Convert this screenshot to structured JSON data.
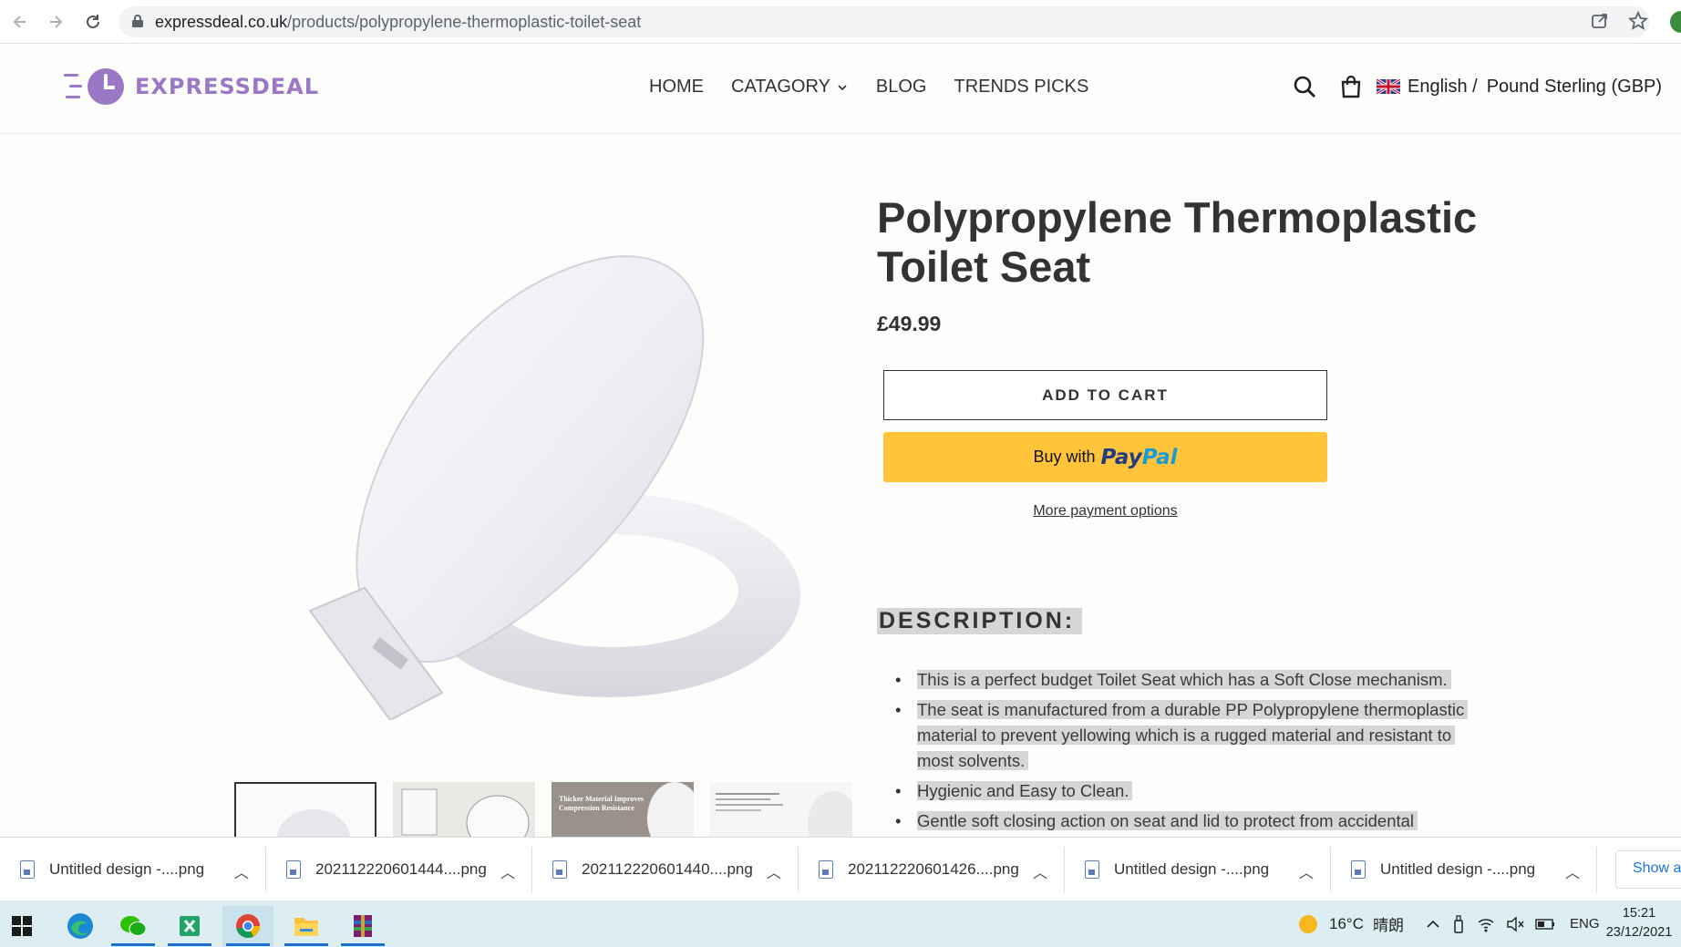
{
  "browser": {
    "url_domain": "expressdeal.co.uk",
    "url_path": "/products/polypropylene-thermoplastic-toilet-seat"
  },
  "store": {
    "logo_text": "EXPRESSDEAL",
    "nav": [
      "HOME",
      "CATAGORY",
      "BLOG",
      "TRENDS PICKS"
    ],
    "language": "English /",
    "currency": "Pound Sterling (GBP)"
  },
  "product": {
    "title": "Polypropylene Thermoplastic Toilet Seat",
    "price": "£49.99",
    "add_to_cart": "ADD TO CART",
    "paypal_prefix": "Buy with",
    "paypal_brand_1": "Pay",
    "paypal_brand_2": "Pal",
    "more_payment": "More payment options",
    "thumb_caption": "Thicker Material Improves Compression Resistance",
    "description_heading": "DESCRIPTION:",
    "description": [
      "This is a perfect budget Toilet Seat which has a Soft Close mechanism.",
      "The seat is manufactured from a durable PP Polypropylene thermoplastic material to prevent yellowing which is a rugged material and resistant to most solvents.",
      "Hygienic and Easy to Clean.",
      "Gentle soft closing action on seat and lid to protect from accidental"
    ]
  },
  "downloads": {
    "items": [
      "Untitled design -....png",
      "202112220601444....png",
      "202112220601440....png",
      "202112220601426....png",
      "Untitled design -....png",
      "Untitled design -....png"
    ],
    "show_all": "Show all"
  },
  "taskbar": {
    "weather": "16°C",
    "weather_desc": "晴朗",
    "lang": "ENG",
    "time": "15:21",
    "date": "23/12/2021"
  },
  "colors": {
    "logo": "#9b78c6",
    "paypal_yellow": "#ffc439",
    "highlight": "#d6d6d6"
  }
}
